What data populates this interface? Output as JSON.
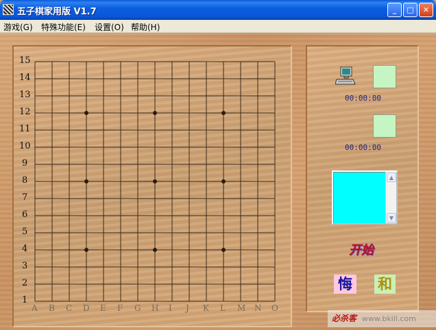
{
  "window": {
    "title": "五子棋家用版 V1.7",
    "controls": {
      "minimize": "_",
      "maximize": "□",
      "close": "✕"
    }
  },
  "menu": [
    {
      "label": "游戏(G)"
    },
    {
      "label": "特殊功能(E)"
    },
    {
      "label": "设置(O)"
    },
    {
      "label": "帮助(H)"
    }
  ],
  "board": {
    "size": 15,
    "row_labels": [
      "15",
      "14",
      "13",
      "12",
      "11",
      "10",
      "9",
      "8",
      "7",
      "6",
      "5",
      "4",
      "3",
      "2",
      "1"
    ],
    "col_labels": [
      "A",
      "B",
      "C",
      "D",
      "E",
      "F",
      "G",
      "H",
      "I",
      "J",
      "K",
      "L",
      "M",
      "N",
      "O"
    ],
    "star_points": [
      [
        "D",
        12
      ],
      [
        "H",
        12
      ],
      [
        "L",
        12
      ],
      [
        "D",
        8
      ],
      [
        "H",
        8
      ],
      [
        "L",
        8
      ],
      [
        "D",
        4
      ],
      [
        "H",
        4
      ],
      [
        "L",
        4
      ]
    ],
    "line_color": "#3a2a1a",
    "star_color": "#2a1a0a"
  },
  "side": {
    "player1": {
      "icon": "computer-icon",
      "time": "00:00:00"
    },
    "player2": {
      "time": "00:00:00"
    },
    "start_label": "开始",
    "undo_label": "悔",
    "draw_label": "和"
  },
  "watermark": {
    "brand": "必杀客",
    "url": "www.bkill.com"
  }
}
